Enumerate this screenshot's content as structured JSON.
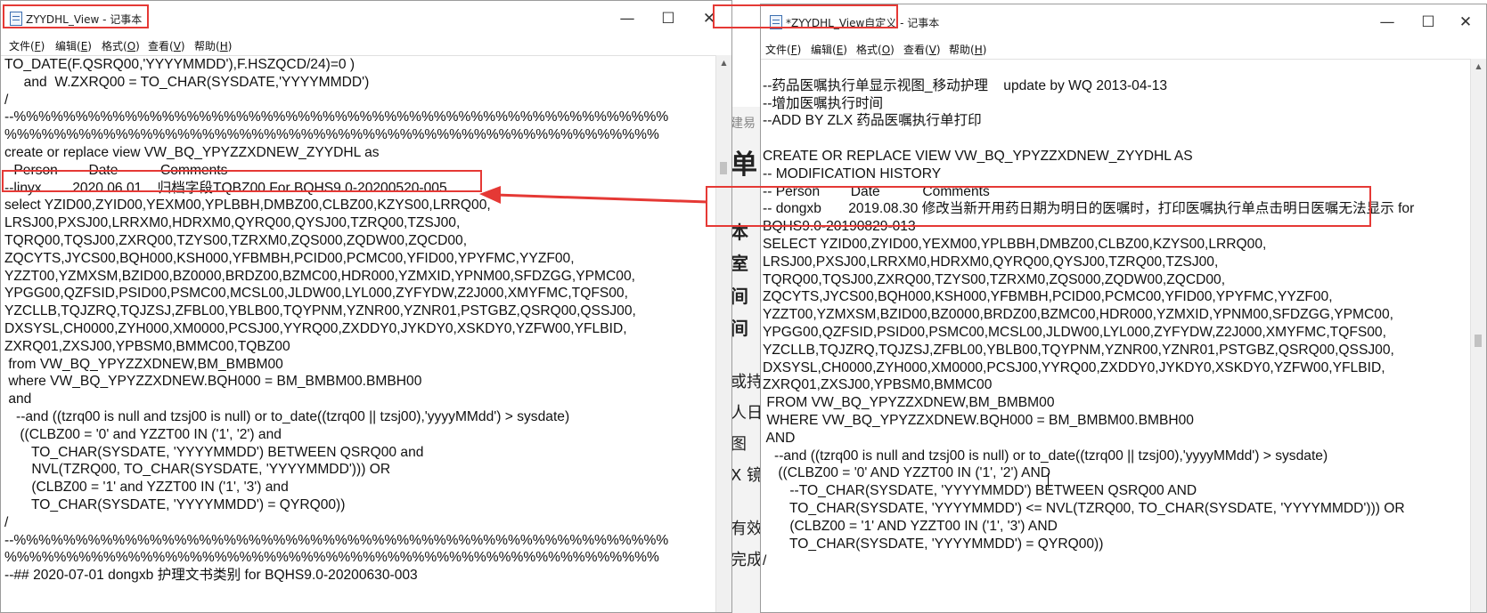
{
  "background_window": {
    "fragments": [
      "建易",
      "单",
      "本",
      "室",
      "间",
      "间",
      "或持",
      "人日",
      "图",
      "X 镜",
      "有效",
      "完成"
    ]
  },
  "left_window": {
    "title": "ZYYDHL_View - 记事本",
    "menu": [
      {
        "label": "文件(",
        "key": "F",
        "suffix": ")"
      },
      {
        "label": "编辑(",
        "key": "E",
        "suffix": ")"
      },
      {
        "label": "格式(",
        "key": "O",
        "suffix": ")"
      },
      {
        "label": "查看(",
        "key": "V",
        "suffix": ")"
      },
      {
        "label": "帮助(",
        "key": "H",
        "suffix": ")"
      }
    ],
    "controls": {
      "minimize": "—",
      "maximize": "☐",
      "close": "✕"
    },
    "lines": [
      "TO_DATE(F.QSRQ00,'YYYYMMDD'),F.HSZQCD/24)=0 )",
      "     and  W.ZXRQ00 = TO_CHAR(SYSDATE,'YYYYMMDD')",
      "/",
      "--%%%%%%%%%%%%%%%%%%%%%%%%%%%%%%%%%%%%%%%%%%%%%%%%%%%%%",
      "%%%%%%%%%%%%%%%%%%%%%%%%%%%%%%%%%%%%%%%%%%%%%%%%%%%%%",
      "create or replace view VW_BQ_YPYZZXDNEW_ZYYDHL as",
      "--Person        Date           Comments",
      "--linyx        2020.06.01    归档字段TQBZ00 For BQHS9.0-20200520-005",
      "select YZID00,ZYID00,YEXM00,YPLBBH,DMBZ00,CLBZ00,KZYS00,LRRQ00,",
      "LRSJ00,PXSJ00,LRRXM0,HDRXM0,QYRQ00,QYSJ00,TZRQ00,TZSJ00,",
      "TQRQ00,TQSJ00,ZXRQ00,TZYS00,TZRXM0,ZQS000,ZQDW00,ZQCD00,",
      "ZQCYTS,JYCS00,BQH000,KSH000,YFBMBH,PCID00,PCMC00,YFID00,YPYFMC,YYZF00,",
      "YZZT00,YZMXSM,BZID00,BZ0000,BRDZ00,BZMC00,HDR000,YZMXID,YPNM00,SFDZGG,YPMC00,",
      "YPGG00,QZFSID,PSID00,PSMC00,MCSL00,JLDW00,LYL000,ZYFYDW,Z2J000,XMYFMC,TQFS00,",
      "YZCLLB,TQJZRQ,TQJZSJ,ZFBL00,YBLB00,TQYPNM,YZNR00,YZNR01,PSTGBZ,QSRQ00,QSSJ00,",
      "DXSYSL,CH0000,ZYH000,XM0000,PCSJ00,YYRQ00,ZXDDY0,JYKDY0,XSKDY0,YZFW00,YFLBID,",
      "ZXRQ01,ZXSJ00,YPBSM0,BMMC00,TQBZ00",
      " from VW_BQ_YPYZZXDNEW,BM_BMBM00",
      " where VW_BQ_YPYZZXDNEW.BQH000 = BM_BMBM00.BMBH00",
      " and",
      "   --and ((tzrq00 is null and tzsj00 is null) or to_date((tzrq00 || tzsj00),'yyyyMMdd') > sysdate)",
      "    ((CLBZ00 = '0' and YZZT00 IN ('1', '2') and",
      "       TO_CHAR(SYSDATE, 'YYYYMMDD') BETWEEN QSRQ00 and",
      "       NVL(TZRQ00, TO_CHAR(SYSDATE, 'YYYYMMDD'))) OR",
      "       (CLBZ00 = '1' and YZZT00 IN ('1', '3') and",
      "       TO_CHAR(SYSDATE, 'YYYYMMDD') = QYRQ00))",
      "/",
      "--%%%%%%%%%%%%%%%%%%%%%%%%%%%%%%%%%%%%%%%%%%%%%%%%%%%%%",
      "%%%%%%%%%%%%%%%%%%%%%%%%%%%%%%%%%%%%%%%%%%%%%%%%%%%%%",
      "--## 2020-07-01 dongxb 护理文书类别 for BQHS9.0-20200630-003"
    ]
  },
  "right_window": {
    "title": "*ZYYDHL_View自定义 - 记事本",
    "menu": [
      {
        "label": "文件(",
        "key": "F",
        "suffix": ")"
      },
      {
        "label": "编辑(",
        "key": "E",
        "suffix": ")"
      },
      {
        "label": "格式(",
        "key": "O",
        "suffix": ")"
      },
      {
        "label": "查看(",
        "key": "V",
        "suffix": ")"
      },
      {
        "label": "帮助(",
        "key": "H",
        "suffix": ")"
      }
    ],
    "controls": {
      "minimize": "—",
      "maximize": "☐",
      "close": "✕"
    },
    "lines": [
      "",
      "--药品医嘱执行单显示视图_移动护理    update by WQ 2013-04-13",
      "--增加医嘱执行时间",
      "--ADD BY ZLX 药品医嘱执行单打印",
      "",
      "CREATE OR REPLACE VIEW VW_BQ_YPYZZXDNEW_ZYYDHL AS",
      "-- MODIFICATION HISTORY",
      "-- Person        Date           Comments",
      "-- dongxb       2019.08.30 修改当新开用药日期为明日的医嘱时，打印医嘱执行单点击明日医嘱无法显示 for",
      "BQHS9.0-20190829-013",
      "SELECT YZID00,ZYID00,YEXM00,YPLBBH,DMBZ00,CLBZ00,KZYS00,LRRQ00,",
      "LRSJ00,PXSJ00,LRRXM0,HDRXM0,QYRQ00,QYSJ00,TZRQ00,TZSJ00,",
      "TQRQ00,TQSJ00,ZXRQ00,TZYS00,TZRXM0,ZQS000,ZQDW00,ZQCD00,",
      "ZQCYTS,JYCS00,BQH000,KSH000,YFBMBH,PCID00,PCMC00,YFID00,YPYFMC,YYZF00,",
      "YZZT00,YZMXSM,BZID00,BZ0000,BRDZ00,BZMC00,HDR000,YZMXID,YPNM00,SFDZGG,YPMC00,",
      "YPGG00,QZFSID,PSID00,PSMC00,MCSL00,JLDW00,LYL000,ZYFYDW,Z2J000,XMYFMC,TQFS00,",
      "YZCLLB,TQJZRQ,TQJZSJ,ZFBL00,YBLB00,TQYPNM,YZNR00,YZNR01,PSTGBZ,QSRQ00,QSSJ00,",
      "DXSYSL,CH0000,ZYH000,XM0000,PCSJ00,YYRQ00,ZXDDY0,JYKDY0,XSKDY0,YZFW00,YFLBID,",
      "ZXRQ01,ZXSJ00,YPBSM0,BMMC00",
      " FROM VW_BQ_YPYZZXDNEW,BM_BMBM00",
      " WHERE VW_BQ_YPYZZXDNEW.BQH000 = BM_BMBM00.BMBH00",
      " AND",
      "   --and ((tzrq00 is null and tzsj00 is null) or to_date((tzrq00 || tzsj00),'yyyyMMdd') > sysdate)",
      "    ((CLBZ00 = '0' AND YZZT00 IN ('1', '2') AND",
      "       --TO_CHAR(SYSDATE, 'YYYYMMDD') BETWEEN QSRQ00 AND",
      "       TO_CHAR(SYSDATE, 'YYYYMMDD') <= NVL(TZRQ00, TO_CHAR(SYSDATE, 'YYYYMMDD'))) OR",
      "       (CLBZ00 = '1' AND YZZT00 IN ('1', '3') AND",
      "       TO_CHAR(SYSDATE, 'YYYYMMDD') = QYRQ00))",
      "/"
    ]
  },
  "colors": {
    "annotation": "#e53935",
    "window_border": "#9c9c9c",
    "scrollbar": "#f0f0f0"
  }
}
